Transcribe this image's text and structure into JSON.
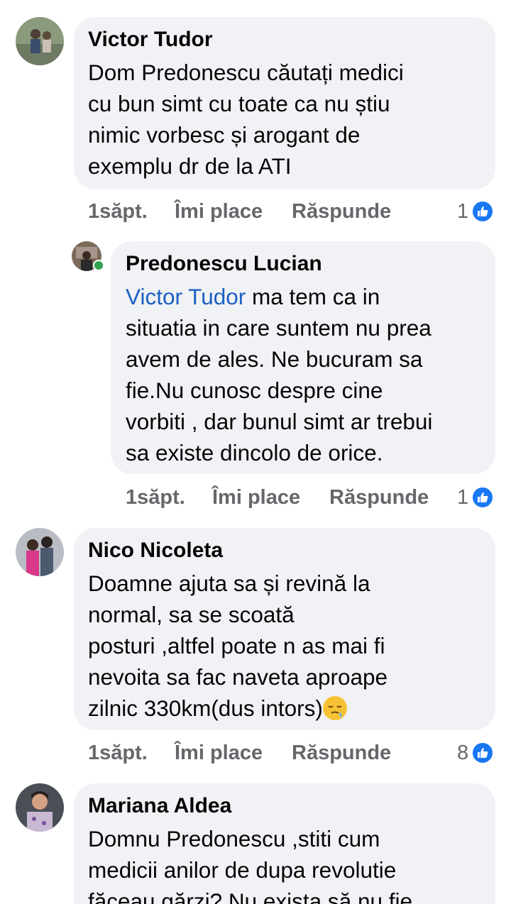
{
  "comments": [
    {
      "author": "Victor Tudor",
      "text": "Dom Predonescu căutați medici\ncu bun simt cu toate ca nu știu\nnimic vorbesc și arogant de\nexemplu dr de la ATI",
      "time": "1săpt.",
      "like_label": "Îmi place",
      "reply_label": "Răspunde",
      "reactions": "1"
    },
    {
      "author": "Predonescu Lucian",
      "mention": "Victor Tudor",
      "text_after_mention": " ma tem ca in\nsituatia in care suntem nu prea\navem de ales. Ne bucuram sa\nfie.Nu cunosc despre cine\nvorbiti , dar bunul simt ar trebui\nsa existe dincolo de orice.",
      "time": "1săpt.",
      "like_label": "Îmi place",
      "reply_label": "Răspunde",
      "reactions": "1"
    },
    {
      "author": "Nico Nicoleta",
      "text": "Doamne ajuta sa și revină la\nnormal, sa se scoată\nposturi ,altfel poate n as mai fi\nnevoita sa fac naveta aproape\nzilnic 330km(dus intors)",
      "emoji": "sleepy-face-emoji",
      "time": "1săpt.",
      "like_label": "Îmi place",
      "reply_label": "Răspunde",
      "reactions": "8"
    },
    {
      "author": "Mariana Aldea",
      "text": "Domnu Predonescu ,stiti cum\nmedicii anilor de dupa revolutie\nfăceau gărzi? Nu exista să nu fie"
    }
  ],
  "colors": {
    "bubble_bg": "#f0f2f5",
    "action_text": "#65676b",
    "mention": "#1b5fc4",
    "like_blue": "#1877f2",
    "online_green": "#31a24c"
  },
  "icons": {
    "reaction": "like-thumb-icon",
    "presence": "online-status-dot"
  }
}
